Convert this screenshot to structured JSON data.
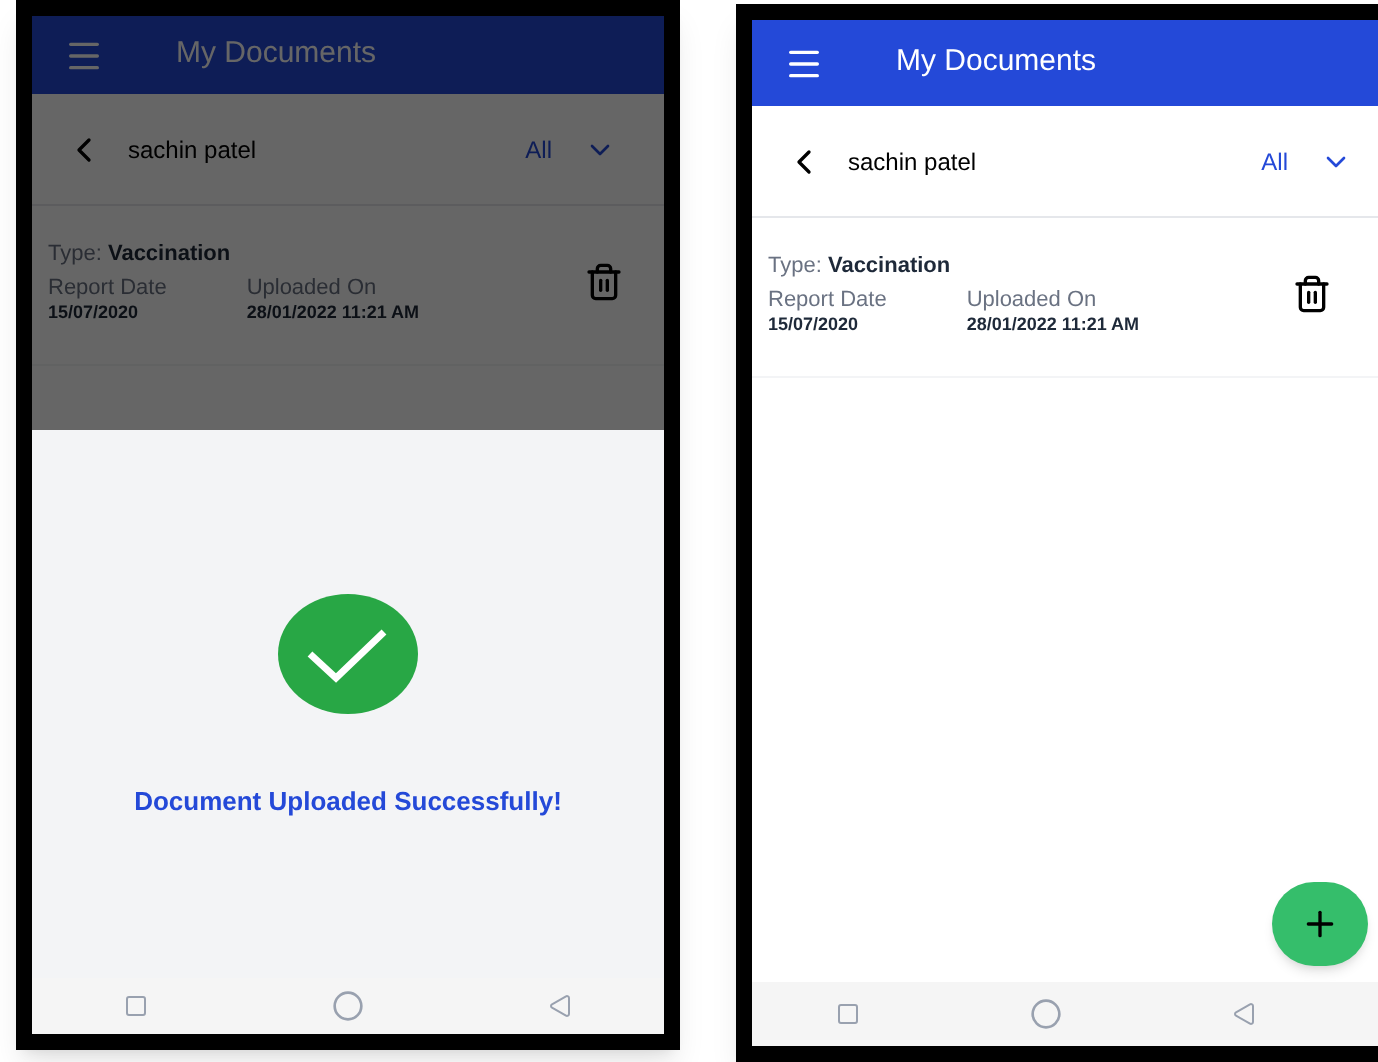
{
  "screens": [
    {
      "header": {
        "title": "My Documents"
      },
      "patient": {
        "name": "sachin patel",
        "filter": "All"
      },
      "documents": [
        {
          "type_label": "Type:",
          "type": "Vaccination",
          "report_date_label": "Report Date",
          "report_date": "15/07/2020",
          "uploaded_label": "Uploaded On",
          "uploaded": "28/01/2022 11:21 AM"
        }
      ],
      "dimmed": true,
      "dialog": {
        "message": "Document Uploaded Successfully!"
      },
      "add_button": false
    },
    {
      "header": {
        "title": "My Documents"
      },
      "patient": {
        "name": "sachin patel",
        "filter": "All"
      },
      "documents": [
        {
          "type_label": "Type:",
          "type": "Vaccination",
          "report_date_label": "Report Date",
          "report_date": "15/07/2020",
          "uploaded_label": "Uploaded On",
          "uploaded": "28/01/2022 11:21 AM"
        }
      ],
      "dimmed": false,
      "add_button": true
    }
  ]
}
